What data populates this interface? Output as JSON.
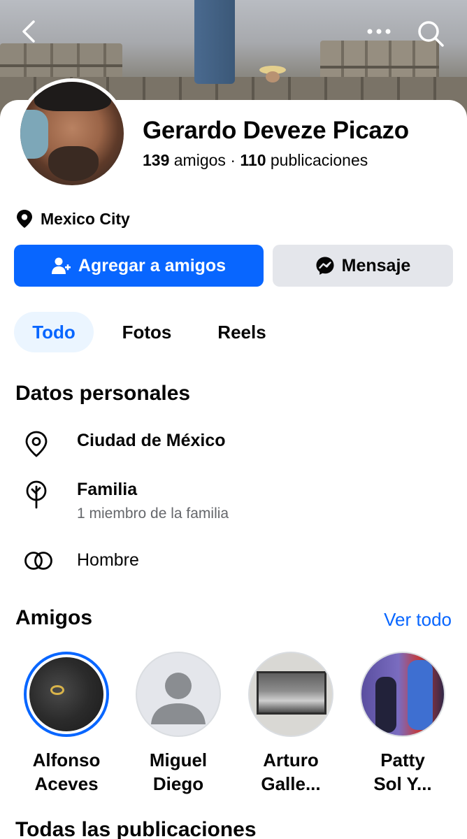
{
  "profile": {
    "name": "Gerardo Deveze Picazo",
    "friends_count": "139",
    "friends_label": "amigos",
    "separator": "·",
    "posts_count": "110",
    "posts_label": "publicaciones",
    "location": "Mexico City"
  },
  "actions": {
    "add_friend": "Agregar a amigos",
    "message": "Mensaje"
  },
  "tabs": [
    {
      "label": "Todo",
      "selected": true
    },
    {
      "label": "Fotos",
      "selected": false
    },
    {
      "label": "Reels",
      "selected": false
    }
  ],
  "personal": {
    "title": "Datos personales",
    "city": "Ciudad de México",
    "family": "Familia",
    "family_sub": "1 miembro de la familia",
    "gender": "Hombre"
  },
  "friends": {
    "title": "Amigos",
    "see_all": "Ver todo",
    "items": [
      {
        "line1": "Alfonso",
        "line2": "Aceves"
      },
      {
        "line1": "Miguel",
        "line2": "Diego"
      },
      {
        "line1": "Arturo",
        "line2": "Galle..."
      },
      {
        "line1": "Patty",
        "line2": "Sol Y..."
      }
    ]
  },
  "posts_section": {
    "title": "Todas las publicaciones"
  },
  "colors": {
    "accent": "#0866ff",
    "secondary_button": "#e4e6eb",
    "selected_tab_bg": "#ebf5ff",
    "muted_text": "#65676b"
  }
}
